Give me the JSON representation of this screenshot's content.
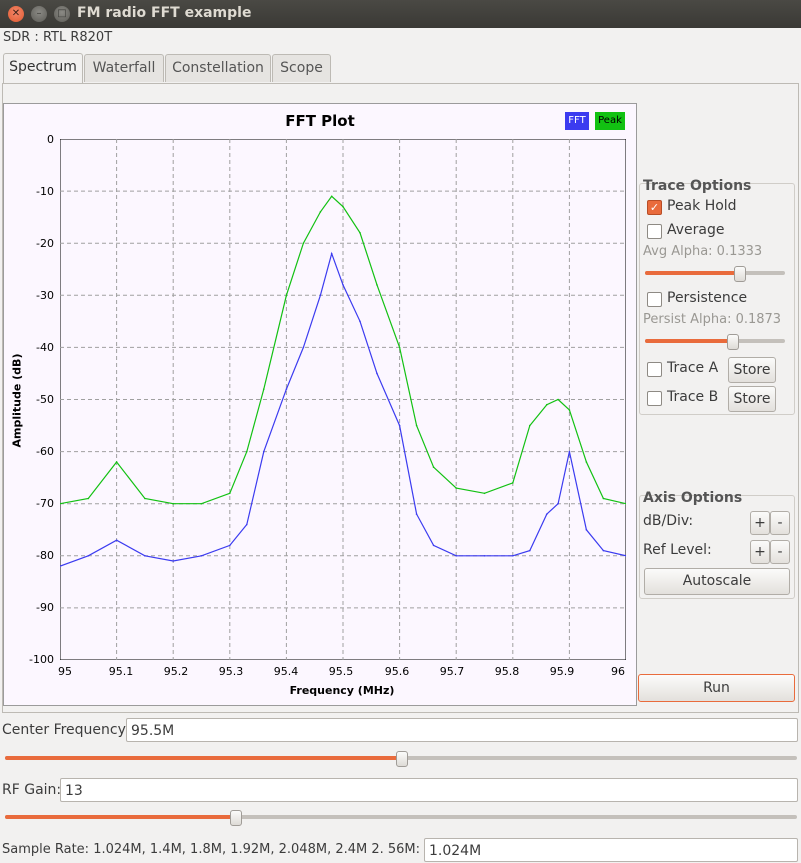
{
  "window": {
    "title": "FM radio FFT example"
  },
  "sdr_label": "SDR : RTL R820T",
  "tabs": [
    "Spectrum",
    "Waterfall",
    "Constellation",
    "Scope"
  ],
  "plot": {
    "title": "FFT Plot",
    "legend": [
      {
        "label": "FFT",
        "color": "#3b3bf0"
      },
      {
        "label": "Peak",
        "color": "#12c112"
      }
    ],
    "y_ticks": [
      "0",
      "-10",
      "-20",
      "-30",
      "-40",
      "-50",
      "-60",
      "-70",
      "-80",
      "-90",
      "-100"
    ],
    "x_ticks": [
      "95",
      "95.1",
      "95.2",
      "95.3",
      "95.4",
      "95.5",
      "95.6",
      "95.7",
      "95.8",
      "95.9",
      "96"
    ],
    "xlabel": "Frequency (MHz)",
    "ylabel": "Amplitude (dB)"
  },
  "chart_data": {
    "type": "line",
    "title": "FFT Plot",
    "xlabel": "Frequency (MHz)",
    "ylabel": "Amplitude (dB)",
    "xlim": [
      95.0,
      96.0
    ],
    "ylim": [
      -100,
      0
    ],
    "grid": true,
    "legend_position": "top-right",
    "x": [
      95.0,
      95.05,
      95.1,
      95.15,
      95.2,
      95.25,
      95.3,
      95.33,
      95.36,
      95.4,
      95.43,
      95.46,
      95.48,
      95.5,
      95.53,
      95.56,
      95.6,
      95.63,
      95.66,
      95.7,
      95.75,
      95.8,
      95.83,
      95.86,
      95.88,
      95.9,
      95.93,
      95.96,
      96.0
    ],
    "series": [
      {
        "name": "FFT",
        "color": "#3b3bf0",
        "values": [
          -82,
          -80,
          -77,
          -80,
          -81,
          -80,
          -78,
          -74,
          -60,
          -48,
          -40,
          -30,
          -22,
          -28,
          -35,
          -45,
          -55,
          -72,
          -78,
          -80,
          -80,
          -80,
          -79,
          -72,
          -70,
          -60,
          -75,
          -79,
          -80
        ]
      },
      {
        "name": "Peak",
        "color": "#12c112",
        "values": [
          -70,
          -69,
          -62,
          -69,
          -70,
          -70,
          -68,
          -60,
          -48,
          -30,
          -20,
          -14,
          -11,
          -13,
          -18,
          -28,
          -40,
          -55,
          -63,
          -67,
          -68,
          -66,
          -55,
          -51,
          -50,
          -52,
          -62,
          -69,
          -70
        ]
      }
    ]
  },
  "trace_options": {
    "title": "Trace Options",
    "peak_hold": "Peak Hold",
    "peak_hold_checked": true,
    "average": "Average",
    "avg_alpha": "Avg Alpha: 0.1333",
    "avg_alpha_level": 0.67,
    "persistence": "Persistence",
    "persist_alpha": "Persist Alpha: 0.1873",
    "persist_alpha_level": 0.62,
    "trace_a": "Trace A",
    "trace_b": "Trace B",
    "store": "Store"
  },
  "axis_options": {
    "title": "Axis Options",
    "db_div": "dB/Div:",
    "ref_level": "Ref Level:",
    "plus": "+",
    "minus": "-",
    "autoscale": "Autoscale"
  },
  "run_label": "Run",
  "center_frequency": {
    "label": "Center Frequency:",
    "value": "95.5M",
    "level": 0.5
  },
  "rf_gain": {
    "label": "RF Gain:",
    "value": "13",
    "level": 0.29
  },
  "sample_rate": {
    "label": "Sample Rate: 1.024M, 1.4M, 1.8M, 1.92M, 2.048M, 2.4M  2. 56M:",
    "value": "1.024M"
  },
  "colors": {
    "accent": "#e96b3c",
    "fft": "#3b3bf0",
    "peak": "#12c112"
  }
}
